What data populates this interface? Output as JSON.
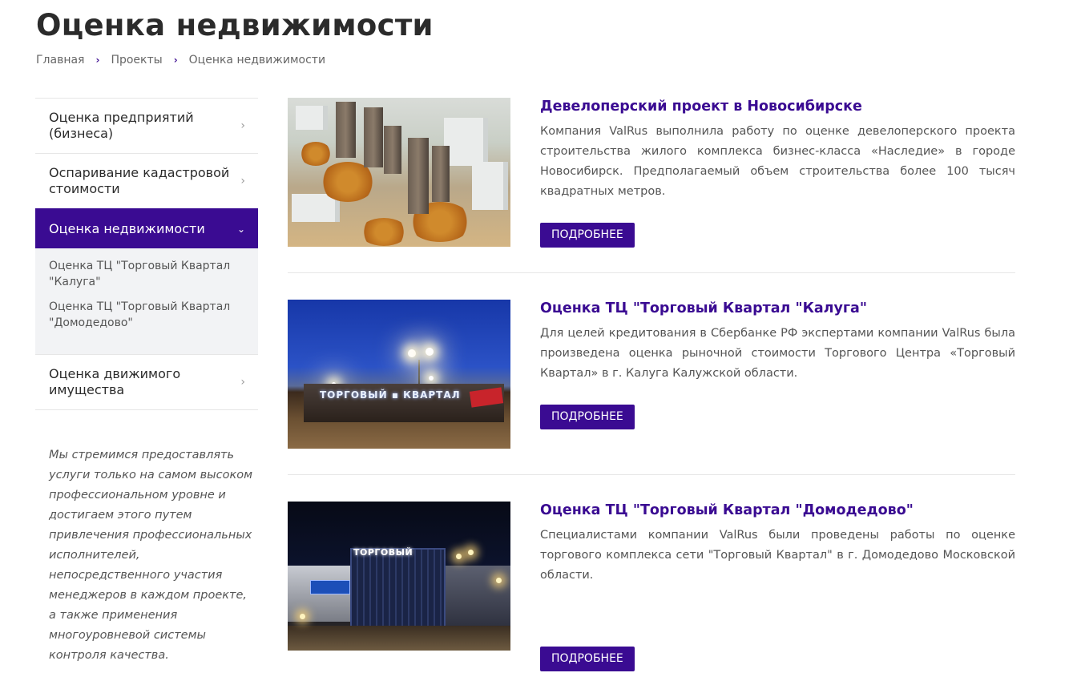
{
  "page": {
    "title": "Оценка недвижимости"
  },
  "breadcrumb": {
    "home": "Главная",
    "projects": "Проекты",
    "current": "Оценка недвижимости",
    "separator": "›"
  },
  "sidebar": {
    "items": [
      {
        "label": "Оценка предприятий (бизнеса)",
        "chevron": "›"
      },
      {
        "label": "Оспаривание кадастровой стоимости",
        "chevron": "›"
      },
      {
        "label": "Оценка недвижимости",
        "chevron": "⌄",
        "active": true
      },
      {
        "label": "Оценка движимого имущества",
        "chevron": "›"
      }
    ],
    "sub_items": [
      {
        "label": "Оценка ТЦ \"Торговый Квартал \"Калуга\""
      },
      {
        "label": "Оценка ТЦ \"Торговый Квартал \"Домодедово\""
      }
    ],
    "note": "Мы стремимся предоставлять услуги только на самом высоком профессиональном уровне и достигаем этого путем привлечения профессиональных исполнителей, непосредственного участия менеджеров в каждом проекте, а также применения многоуровневой системы контроля качества."
  },
  "projects": [
    {
      "title": "Девелоперский проект в Новосибирске",
      "text": "Компания ValRus выполнила работу по оценке девелоперского проекта строительства жилого комплекса бизнес-класса «Наследие» в городе Новосибирск. Предполагаемый объем строительства более 100 тысяч квадратных метров.",
      "button": "ПОДРОБНЕЕ"
    },
    {
      "title": "Оценка ТЦ \"Торговый Квартал \"Калуга\"",
      "text": "Для целей кредитования в Сбербанке РФ экспертами компании ValRus была произведена оценка рыночной стоимости Торгового Центра «Торговый Квартал» в г. Калуга Калужской области.",
      "button": "ПОДРОБНЕЕ"
    },
    {
      "title": "Оценка ТЦ \"Торговый Квартал \"Домодедово\"",
      "text": "Специалистами компании ValRus  были проведены работы по оценке торгового комплекса сети \"Торговый Квартал\" в г. Домодедово Московской области.",
      "button": "ПОДРОБНЕЕ"
    }
  ],
  "thumb_signs": {
    "kaluga": "ТОРГОВЫЙ ▪ КВАРТАЛ",
    "domodedovo": "ТОРГОВЫЙ"
  },
  "colors": {
    "accent": "#3a0b92",
    "sub_bg": "#f2f3f5"
  }
}
